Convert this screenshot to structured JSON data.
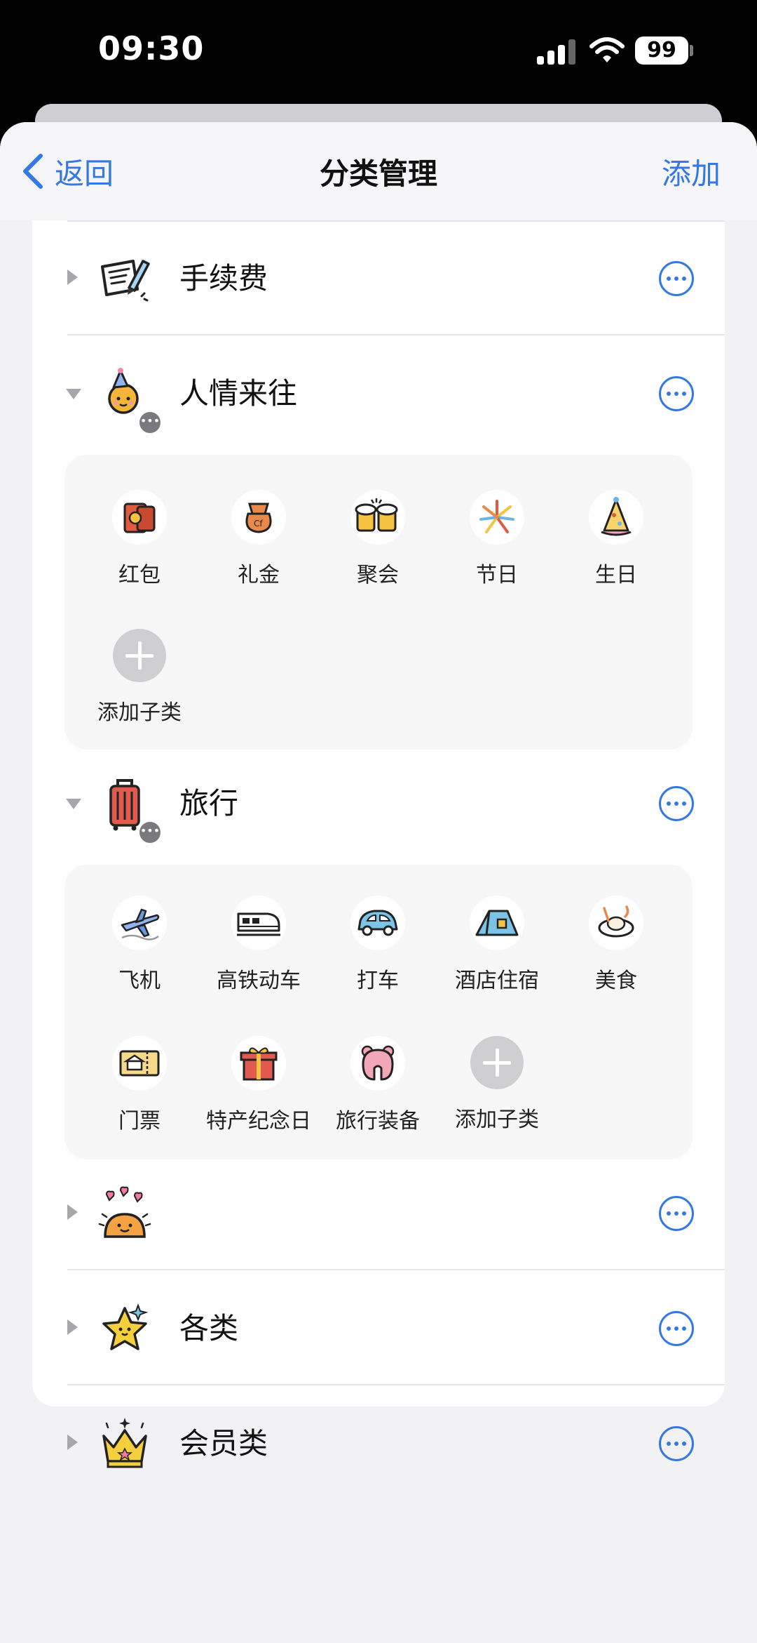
{
  "status_bar": {
    "time": "09:30",
    "battery": "99"
  },
  "nav": {
    "back_label": "返回",
    "title": "分类管理",
    "add_label": "添加"
  },
  "categories": [
    {
      "label": "手续费",
      "icon": "receipt-pen-icon",
      "expanded": false
    },
    {
      "label": "人情来往",
      "icon": "party-sun-icon",
      "expanded": true,
      "subcategories": [
        {
          "label": "红包",
          "icon": "red-envelope-icon"
        },
        {
          "label": "礼金",
          "icon": "money-bag-icon"
        },
        {
          "label": "聚会",
          "icon": "beer-mugs-icon"
        },
        {
          "label": "节日",
          "icon": "fireworks-icon"
        },
        {
          "label": "生日",
          "icon": "party-hat-icon"
        }
      ],
      "add_sub_label": "添加子类"
    },
    {
      "label": "旅行",
      "icon": "suitcase-icon",
      "expanded": true,
      "subcategories": [
        {
          "label": "飞机",
          "icon": "airplane-icon"
        },
        {
          "label": "高铁动车",
          "icon": "train-icon"
        },
        {
          "label": "打车",
          "icon": "car-icon"
        },
        {
          "label": "酒店住宿",
          "icon": "tent-icon"
        },
        {
          "label": "美食",
          "icon": "food-plate-icon"
        },
        {
          "label": "门票",
          "icon": "ticket-icon"
        },
        {
          "label": "特产纪念日",
          "icon": "gift-icon"
        },
        {
          "label": "旅行装备",
          "icon": "neck-pillow-icon"
        }
      ],
      "add_sub_label": "添加子类"
    },
    {
      "label": "",
      "icon": "sun-hearts-icon",
      "expanded": false
    },
    {
      "label": "各类",
      "icon": "star-icon",
      "expanded": false
    },
    {
      "label": "会员类",
      "icon": "crown-icon",
      "expanded": false
    }
  ],
  "colors": {
    "accent": "#3478e4",
    "panel": "#f7f7f8",
    "background": "#f2f2f4"
  }
}
